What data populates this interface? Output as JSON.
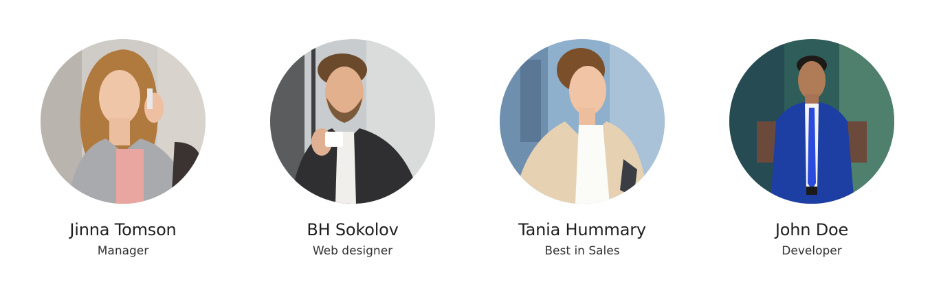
{
  "team": {
    "members": [
      {
        "name": "Jinna Tomson",
        "role": "Manager",
        "photo": "woman-on-phone-photo"
      },
      {
        "name": "BH Sokolov",
        "role": "Web designer",
        "photo": "man-with-coffee-photo"
      },
      {
        "name": "Tania Hummary",
        "role": "Best in Sales",
        "photo": "businesswoman-photo"
      },
      {
        "name": "John Doe",
        "role": "Developer",
        "photo": "man-in-blue-suit-photo"
      }
    ]
  }
}
